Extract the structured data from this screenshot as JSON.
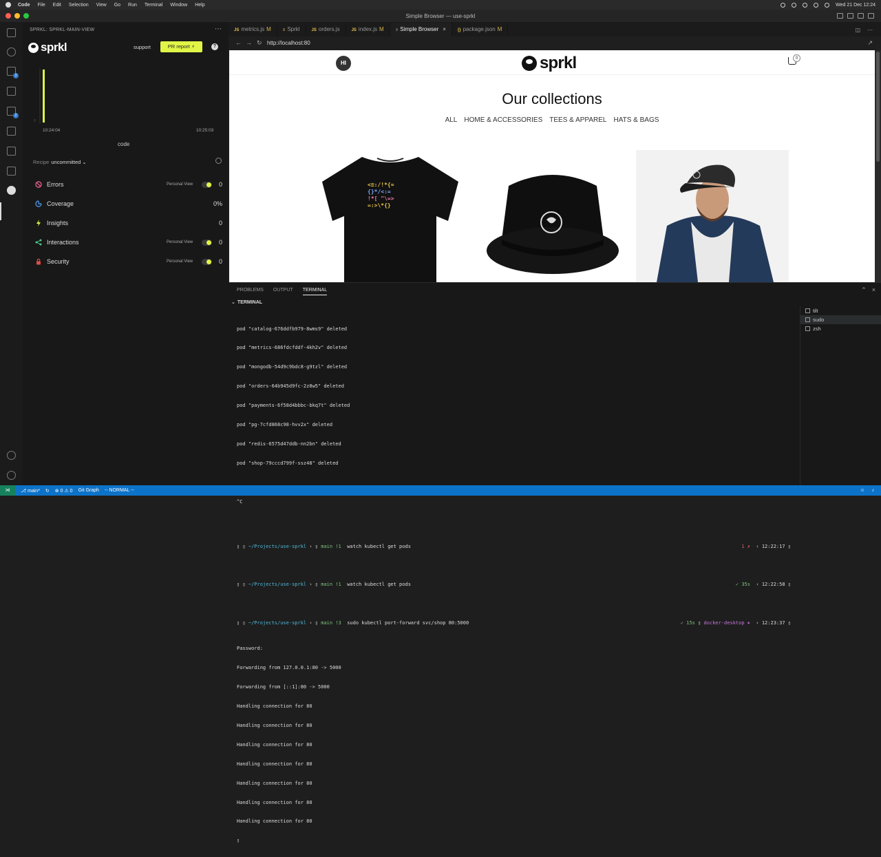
{
  "menubar": {
    "app": "Code",
    "items": [
      "File",
      "Edit",
      "Selection",
      "View",
      "Go",
      "Run",
      "Terminal",
      "Window",
      "Help"
    ],
    "clock": "Wed 21 Dec  12:24"
  },
  "window": {
    "title": "Simple Browser — use-sprkl"
  },
  "sidebar": {
    "header": "SPRKL: SPRKL-MAIN-VIEW",
    "brand": "sprkl",
    "support": "support",
    "pr_button": "PR report ⚡",
    "help": "?",
    "chart": {
      "tick_zero": "0",
      "time_start": "10:24:04",
      "time_end": "10:25:03",
      "tag": "code"
    },
    "recipe": {
      "label": "Recipe",
      "value": "uncommitted ⌄"
    },
    "metrics": [
      {
        "label": "Errors",
        "personal_view": "Personal View",
        "value": "0",
        "color": "#e05a8a"
      },
      {
        "label": "Coverage",
        "personal_view": "",
        "value": "0%",
        "color": "#4a90d9"
      },
      {
        "label": "Insights",
        "personal_view": "",
        "value": "0",
        "color": "#e1f547"
      },
      {
        "label": "Interactions",
        "personal_view": "Personal View",
        "value": "0",
        "color": "#4cc38a"
      },
      {
        "label": "Security",
        "personal_view": "Personal View",
        "value": "0",
        "color": "#e04a4a"
      }
    ]
  },
  "tabs": [
    {
      "lang": "JS",
      "name": "metrics.js",
      "mod": "M"
    },
    {
      "lang": "",
      "name": "Sprkl",
      "mod": ""
    },
    {
      "lang": "JS",
      "name": "orders.js",
      "mod": ""
    },
    {
      "lang": "JS",
      "name": "index.js",
      "mod": "M"
    },
    {
      "lang": "",
      "name": "Simple Browser",
      "mod": "",
      "active": true
    },
    {
      "lang": "{}",
      "name": "package.json",
      "mod": "M"
    }
  ],
  "browser": {
    "url": "http://localhost:80"
  },
  "webpage": {
    "avatar": "HI",
    "brand": "sprkl",
    "cart_count": "0",
    "title": "Our collections",
    "filters": [
      "ALL",
      "HOME & ACCESSORIES",
      "TEES & APPAREL",
      "HATS & BAGS"
    ]
  },
  "panel": {
    "tabs": [
      "PROBLEMS",
      "OUTPUT",
      "TERMINAL"
    ],
    "header": "TERMINAL",
    "pods": [
      "pod \"catalog-676ddfb979-8wms9\" deleted",
      "pod \"metrics-686fdcfddf-4kh2v\" deleted",
      "pod \"mongodb-54d9c9bdc8-g9tzl\" deleted",
      "pod \"orders-64b945d9fc-2z8w5\" deleted",
      "pod \"payments-6f58d4bbbc-bkq7t\" deleted",
      "pod \"pg-7cfd868c98-hvv2x\" deleted",
      "pod \"redis-6575d47ddb-nn2bn\" deleted",
      "pod \"shop-79cccd799f-ssz48\" deleted"
    ],
    "interrupt": "^C",
    "prompts": [
      {
        "path": "~/Projects/use-sprkl",
        "branch": "main !1",
        "cmd": "watch kubectl get pods",
        "right_status": "1 ✗",
        "right_time": "12:22:17"
      },
      {
        "path": "~/Projects/use-sprkl",
        "branch": "main !1",
        "cmd": "watch kubectl get pods",
        "right_status": "✓ 35s",
        "right_time": "12:22:58"
      },
      {
        "path": "~/Projects/use-sprkl",
        "branch": "main !3",
        "cmd": "sudo kubectl port-forward svc/shop 80:5000",
        "right_status": "✓ 15s",
        "right_ctx": "docker-desktop ⎈",
        "right_time": "12:23:37"
      }
    ],
    "output": [
      "Password:",
      "Forwarding from 127.0.0.1:80 -> 5000",
      "Forwarding from [::1]:80 -> 5000",
      "Handling connection for 80",
      "Handling connection for 80",
      "Handling connection for 80",
      "Handling connection for 80",
      "Handling connection for 80",
      "Handling connection for 80",
      "Handling connection for 80"
    ],
    "terminals": [
      "tilt",
      "sudo",
      "zsh"
    ]
  },
  "statusbar": {
    "branch": "main*",
    "problems": "⊗ 0 ⚠ 0",
    "git_graph": "Git Graph",
    "mode": "-- NORMAL --"
  }
}
